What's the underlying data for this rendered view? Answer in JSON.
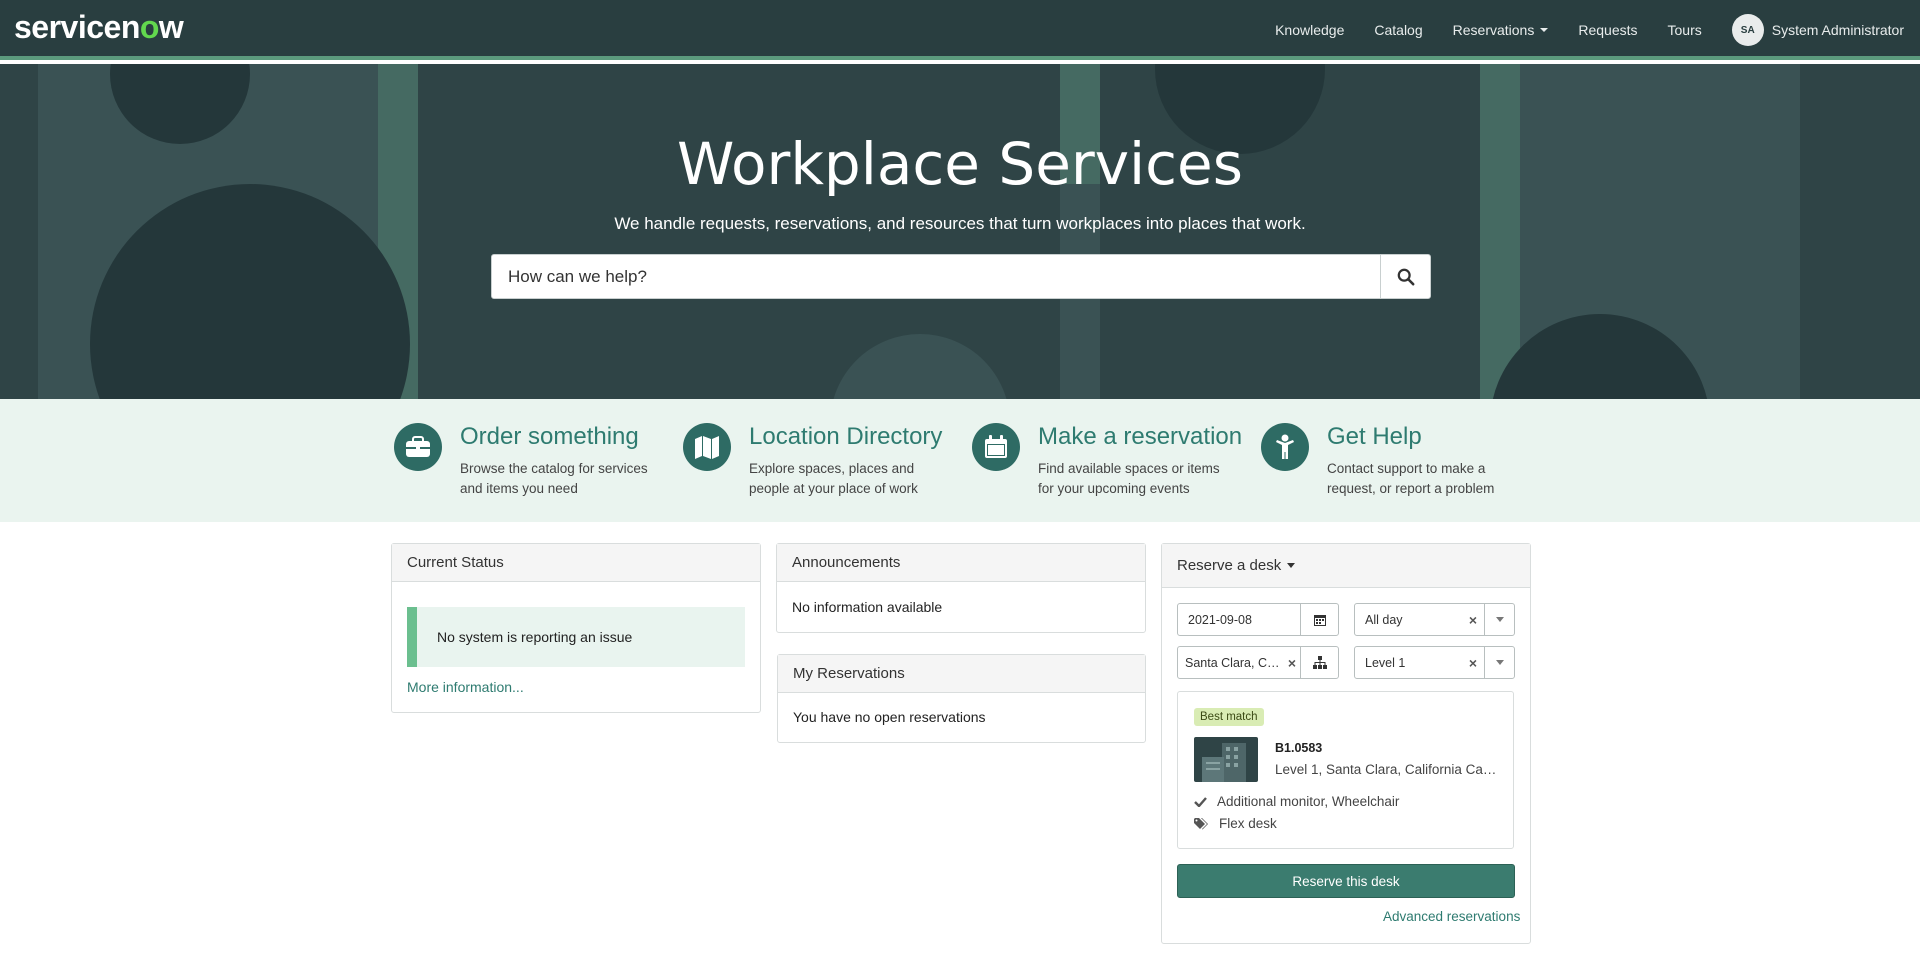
{
  "header": {
    "logo_pre": "servicen",
    "logo_o": "o",
    "logo_post": "w",
    "nav": [
      "Knowledge",
      "Catalog",
      "Reservations",
      "Requests",
      "Tours"
    ],
    "user_initials": "SA",
    "user_name": "System Administrator"
  },
  "hero": {
    "title": "Workplace Services",
    "subtitle": "We handle requests, reservations, and resources that turn workplaces into places that work.",
    "search_placeholder": "How can we help?"
  },
  "quick_links": [
    {
      "title": "Order something",
      "desc": "Browse the catalog for services and items you need",
      "icon": "briefcase-icon"
    },
    {
      "title": "Location Directory",
      "desc": "Explore spaces, places and people at your place of work",
      "icon": "map-icon"
    },
    {
      "title": "Make a reservation",
      "desc": "Find available spaces or items for your upcoming events",
      "icon": "calendar-icon"
    },
    {
      "title": "Get Help",
      "desc": "Contact support to make a request, or report a problem",
      "icon": "person-help-icon"
    }
  ],
  "current_status": {
    "title": "Current Status",
    "message": "No system is reporting an issue",
    "more": "More information..."
  },
  "announcements": {
    "title": "Announcements",
    "body": "No information available"
  },
  "my_reservations": {
    "title": "My Reservations",
    "body": "You have no open reservations"
  },
  "reserve": {
    "title": "Reserve a desk",
    "date": "2021-09-08",
    "time": "All day",
    "location": "Santa Clara, Cal...",
    "level": "Level 1",
    "badge": "Best match",
    "desk_id": "B1.0583",
    "desk_location": "Level 1, Santa Clara, California Cam...",
    "features": "Additional monitor, Wheelchair",
    "type": "Flex desk",
    "button": "Reserve this desk",
    "advanced": "Advanced reservations"
  },
  "colors": {
    "header_bg": "#293e40",
    "accent": "#2e7b70",
    "button": "#3b7c6f",
    "band_bg": "#eaf4ef"
  }
}
